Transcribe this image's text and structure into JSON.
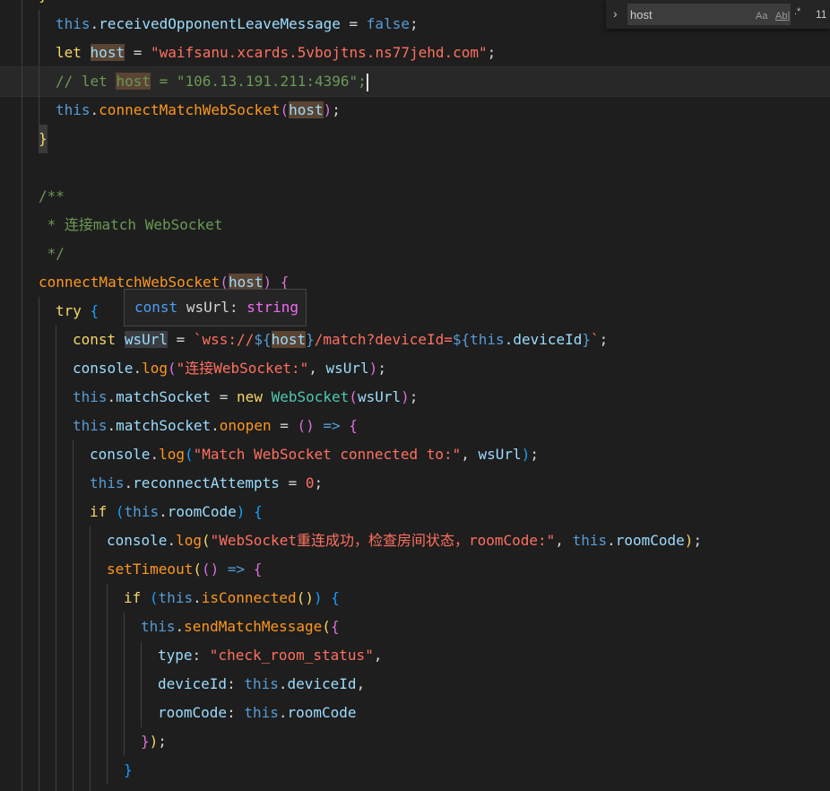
{
  "find": {
    "query": "host",
    "toggle_icon": "chevron-right-icon",
    "match_case_label": "Aa",
    "whole_word_label": "Ab|",
    "regex_label": ".*",
    "result_count": "11"
  },
  "hover": {
    "keyword": "const",
    "name": "wsUrl",
    "colon": ":",
    "type": "string"
  },
  "code": {
    "l1": {
      "a": "this",
      ".": ".",
      "b": "receivedOpponentLeaveMessage",
      " = ": " = ",
      "c": "false",
      ";": ";"
    },
    "l2": {
      "a": "let",
      "b": "host",
      "c": "\"waifsanu.xcards.5vbojtns.ns77jehd.com\""
    },
    "l3": {
      "a": "// let ",
      "b": "host",
      "c": " = \"106.13.191.211:4396\";"
    },
    "l4": {
      "a": "this",
      "b": "connectMatchWebSocket",
      "c": "host"
    },
    "l5": {
      "a": "}"
    },
    "l7": {
      "a": "/**"
    },
    "l8": {
      "a": " * 连接match WebSocket"
    },
    "l9": {
      "a": " */"
    },
    "l10": {
      "a": "connectMatchWebSocket",
      "b": "host"
    },
    "l11": {
      "a": "try"
    },
    "l12": {
      "a": "const",
      "b": "wsUrl",
      "c": "`wss://",
      "d": "${",
      "e": "host",
      "f": "}",
      "g": "/match?deviceId=",
      "h": "${",
      "i": "this",
      "j": ".deviceId",
      "k": "}",
      "l": "`"
    },
    "l13": {
      "a": "console",
      "b": "log",
      "c": "\"连接WebSocket:\"",
      "d": "wsUrl"
    },
    "l14": {
      "a": "this",
      "b": "matchSocket",
      "c": "new",
      "d": "WebSocket",
      "e": "wsUrl"
    },
    "l15": {
      "a": "this",
      "b": "matchSocket",
      "c": "onopen"
    },
    "l16": {
      "a": "console",
      "b": "log",
      "c": "\"Match WebSocket connected to:\"",
      "d": "wsUrl"
    },
    "l17": {
      "a": "this",
      "b": "reconnectAttempts",
      "c": "0"
    },
    "l18": {
      "a": "if",
      "b": "this",
      "c": "roomCode"
    },
    "l19": {
      "a": "console",
      "b": "log",
      "c": "\"WebSocket重连成功，检查房间状态，roomCode:\"",
      "d": "this",
      "e": "roomCode"
    },
    "l20": {
      "a": "setTimeout"
    },
    "l21": {
      "a": "if",
      "b": "this",
      "c": "isConnected"
    },
    "l22": {
      "a": "this",
      "b": "sendMatchMessage"
    },
    "l23": {
      "a": "type",
      "b": "\"check_room_status\""
    },
    "l24": {
      "a": "deviceId",
      "b": "this",
      "c": "deviceId"
    },
    "l25": {
      "a": "roomCode",
      "b": "this",
      "c": "roomCode"
    },
    "l26": {
      "a": "});"
    },
    "l27": {
      "a": "}"
    }
  }
}
